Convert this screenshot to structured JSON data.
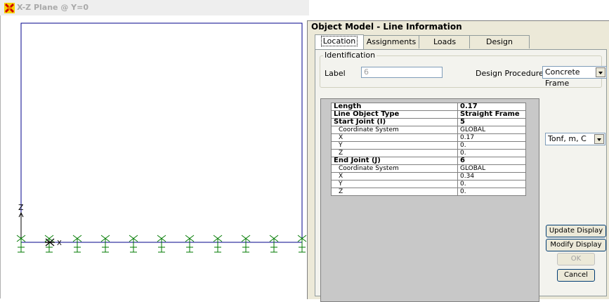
{
  "viewport": {
    "title": "X-Z Plane @ Y=0",
    "axis_z_label": "Z",
    "axis_x_label": "X"
  },
  "dialog": {
    "title": "Object Model - Line Information",
    "tabs": [
      {
        "label": "Location",
        "active": true
      },
      {
        "label": "Assignments",
        "active": false
      },
      {
        "label": "Loads",
        "active": false
      },
      {
        "label": "Design",
        "active": false
      }
    ],
    "identification": {
      "caption": "Identification",
      "label_caption": "Label",
      "label_value": "6",
      "design_procedure_caption": "Design Procedure",
      "design_procedure_value": "Concrete Frame"
    },
    "units_value": "Tonf, m, C",
    "properties": [
      {
        "key": "Length",
        "value": "0.17",
        "header": true
      },
      {
        "key": "Line Object Type",
        "value": "Straight Frame",
        "header": true
      },
      {
        "key": "Start Joint (I)",
        "value": "5",
        "header": true
      },
      {
        "key": "Coordinate System",
        "value": "GLOBAL",
        "header": false
      },
      {
        "key": "X",
        "value": "0.17",
        "header": false
      },
      {
        "key": "Y",
        "value": "0.",
        "header": false
      },
      {
        "key": "Z",
        "value": "0.",
        "header": false
      },
      {
        "key": "End Joint (J)",
        "value": "6",
        "header": true
      },
      {
        "key": "Coordinate System",
        "value": "GLOBAL",
        "header": false
      },
      {
        "key": "X",
        "value": "0.34",
        "header": false
      },
      {
        "key": "Y",
        "value": "0.",
        "header": false
      },
      {
        "key": "Z",
        "value": "0.",
        "header": false
      }
    ],
    "buttons": {
      "update_display": "Update Display",
      "modify_display": "Modify Display",
      "ok": "OK",
      "cancel": "Cancel"
    }
  },
  "colors": {
    "frame_line": "#00008b",
    "support_symbol": "#007a00",
    "selected_joint": "#000000"
  }
}
